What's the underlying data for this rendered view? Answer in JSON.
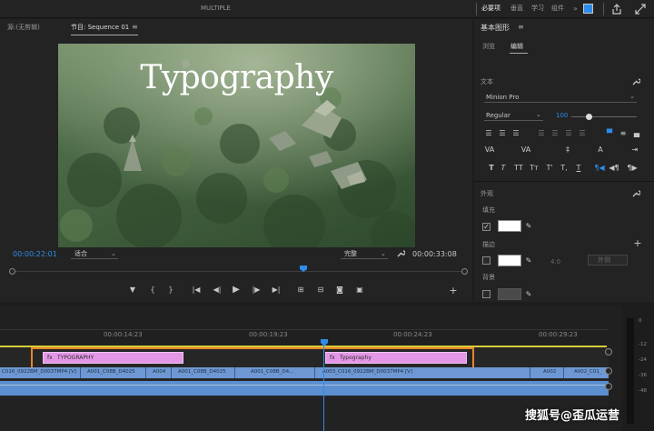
{
  "app": {
    "workspace_title": "MULTIPLE",
    "workspaces": [
      "必要项",
      "垂直",
      "学习",
      "组件"
    ]
  },
  "source_monitor": {
    "tab_source": "源:(无剪辑)",
    "tab_program": "节目: Sequence 01"
  },
  "program": {
    "overlay_text": "Typography",
    "current_timecode": "00:00:22:01",
    "fit_label": "适合",
    "quality_label": "完整",
    "duration_timecode": "00:00:33:08",
    "playhead_fraction": 0.645
  },
  "essential_graphics": {
    "title": "基本图形",
    "tab_browse": "浏览",
    "tab_edit": "编辑",
    "text_section": "文本",
    "font_family": "Minion Pro",
    "font_style": "Regular",
    "font_size": "100",
    "appearance_section": "外观",
    "fill_label": "填充",
    "stroke_label": "描边",
    "stroke_width": "4.0",
    "stroke_type": "外侧",
    "background_label": "背景",
    "fill_checked": true,
    "stroke_checked": false,
    "background_checked": false,
    "fill_color": "#ffffff",
    "stroke_color": "#ffffff",
    "background_color": "#4a4a4a"
  },
  "timeline": {
    "ticks": [
      "00:00:14:23",
      "00:00:19:23",
      "00:00:24:23",
      "00:00:29:23"
    ],
    "graphic_clips": [
      "TYPOGRAPHY",
      "Typography"
    ],
    "video_clips": [
      "C016_0922BM_D0037MP4 [V]",
      "A001_C08B_D4025",
      "A004",
      "A001_C08B_D4025",
      "A001_C08B_D4...",
      "A003_C016_0922BM_D0037MP4 [V]",
      "A002",
      "A002_C01_"
    ]
  },
  "audio_meter": {
    "labels": [
      "0",
      "-12",
      "-24",
      "-36",
      "-48"
    ]
  },
  "watermark": "搜狐号@歪瓜运营",
  "colors": {
    "accent": "#2d8ceb",
    "highlight": "#e8862a",
    "graphic_clip": "#e597e7",
    "video_clip": "#6d98d3",
    "work_area": "#d8cc3a"
  }
}
